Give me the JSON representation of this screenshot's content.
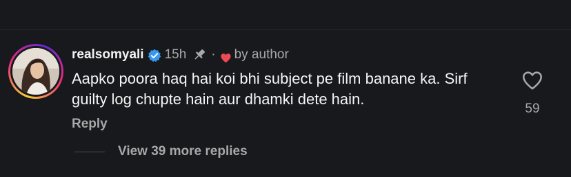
{
  "comment": {
    "username": "realsomyali",
    "verified_icon": "verified-badge-icon",
    "time": "15h",
    "pin_icon": "pin-icon",
    "separator": "·",
    "author_heart_icon": "heart-filled-icon",
    "by_author": "by author",
    "text": "Aapko poora haq hai koi bhi subject pe film banane ka. Sirf guilty log chupte hain aur dhamki dete hain.",
    "reply_label": "Reply",
    "like_icon": "heart-outline-icon",
    "like_count": "59",
    "view_replies_label": "View 39 more replies"
  },
  "colors": {
    "background": "#18191d",
    "text_primary": "#f2f2f2",
    "text_secondary": "#a8a8a8",
    "verified_blue": "#3897f0",
    "heart_red": "#ed4956"
  }
}
